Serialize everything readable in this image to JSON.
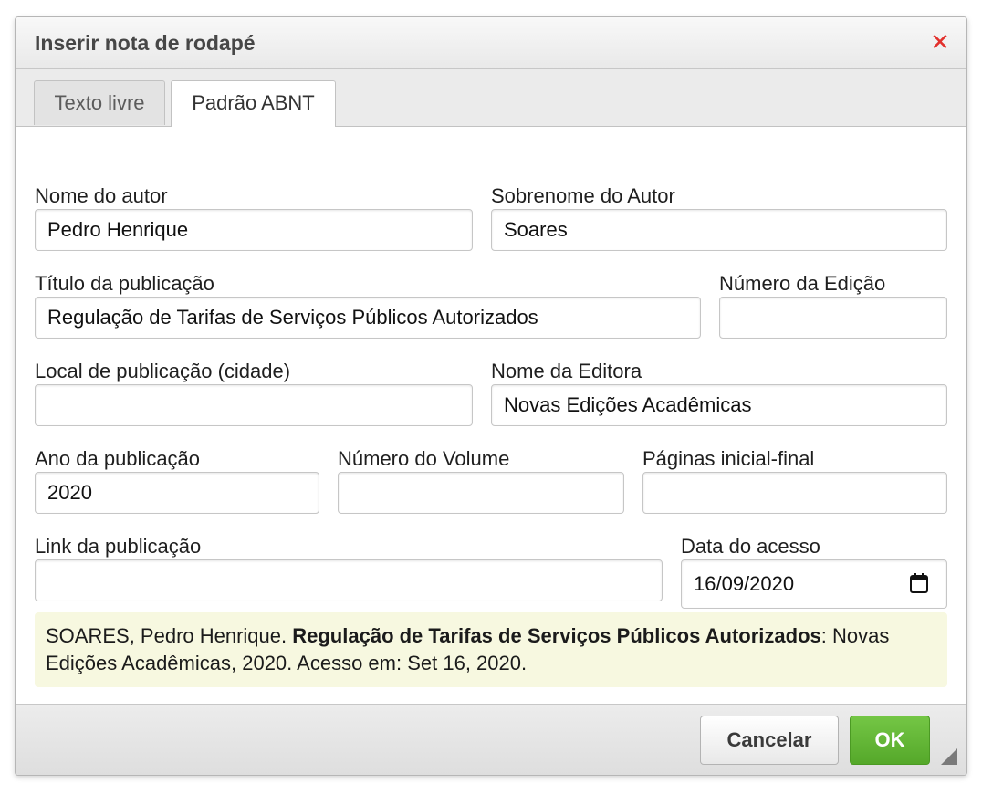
{
  "dialog": {
    "title": "Inserir nota de rodapé",
    "close_icon": "close-icon",
    "close_glyph": "✕"
  },
  "tabs": [
    {
      "label": "Texto livre",
      "active": false
    },
    {
      "label": "Padrão ABNT",
      "active": true
    }
  ],
  "form": {
    "author_first": {
      "label": "Nome do autor",
      "value": "Pedro Henrique"
    },
    "author_last": {
      "label": "Sobrenome do Autor",
      "value": "Soares"
    },
    "title": {
      "label": "Título da publicação",
      "value": "Regulação de Tarifas de Serviços Públicos Autorizados"
    },
    "edition": {
      "label": "Número da Edição",
      "value": ""
    },
    "place": {
      "label": "Local de publicação (cidade)",
      "value": ""
    },
    "publisher": {
      "label": "Nome da Editora",
      "value": "Novas Edições Acadêmicas"
    },
    "year": {
      "label": "Ano da publicação",
      "value": "2020"
    },
    "volume": {
      "label": "Número do Volume",
      "value": ""
    },
    "pages": {
      "label": "Páginas inicial-final",
      "value": ""
    },
    "link": {
      "label": "Link da publicação",
      "value": ""
    },
    "access_date": {
      "label": "Data do acesso",
      "value": "16/09/2020",
      "icon": "calendar-icon"
    }
  },
  "preview": {
    "prefix": "SOARES, Pedro Henrique. ",
    "bold_title": "Regulação de Tarifas de Serviços Públicos Autorizados",
    "suffix": ": Novas Edições Acadêmicas, 2020. Acesso em: Set 16, 2020."
  },
  "buttons": {
    "cancel": "Cancelar",
    "ok": "OK"
  },
  "colors": {
    "close": "#e2302c",
    "ok_button": "#5cb531",
    "preview_bg": "#f7f8e0"
  }
}
